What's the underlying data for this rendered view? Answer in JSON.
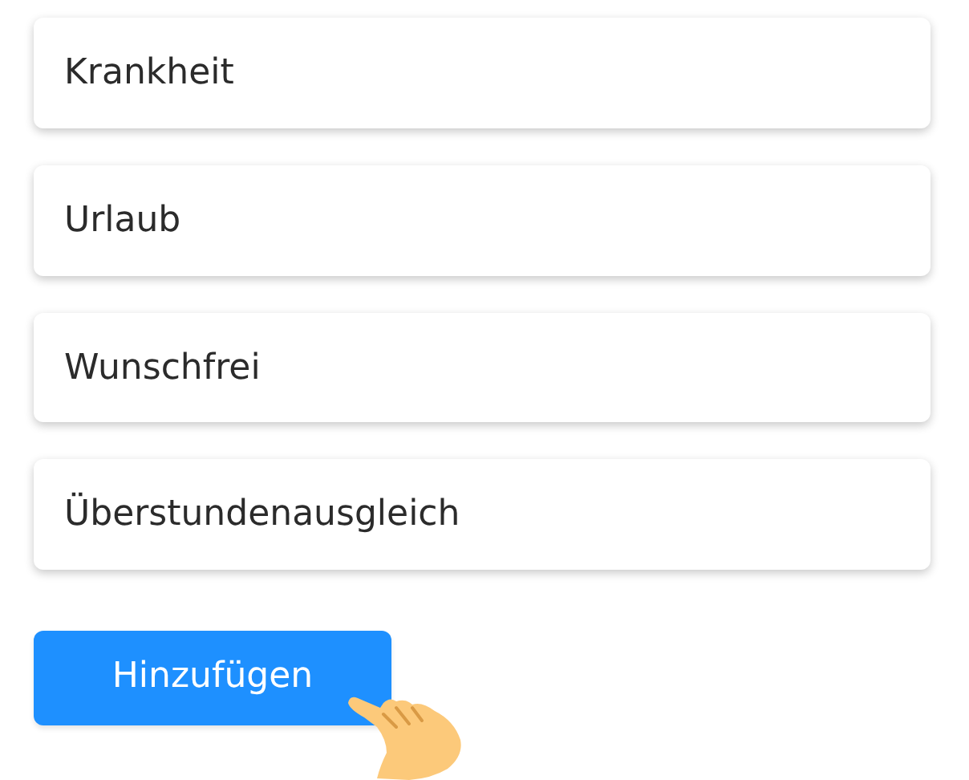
{
  "items": [
    {
      "label": "Krankheit"
    },
    {
      "label": "Urlaub"
    },
    {
      "label": "Wunschfrei"
    },
    {
      "label": "Überstundenausgleich"
    }
  ],
  "add_button": {
    "label": "Hinzufügen"
  }
}
